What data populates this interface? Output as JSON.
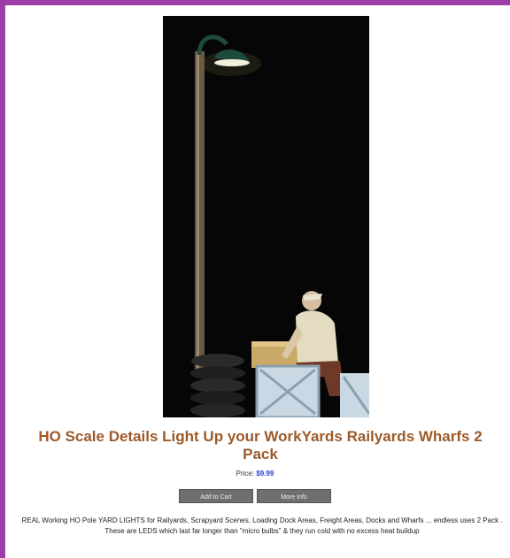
{
  "product": {
    "title": "HO Scale Details Light Up your WorkYards Railyards Wharfs 2 Pack",
    "title_line1": "HO Scale Details Light Up your WorkYards Railyards Wharfs 2",
    "title_line2": "Pack",
    "price_label": "Price: ",
    "price_value": "$9.99",
    "add_to_cart_label": "Add to Cart",
    "more_info_label": "More Info",
    "description": "REAL Working HO Pole YARD LIGHTS for Railyards, Scrapyard Scenes, Loading Dock Areas, Freight Areas, Docks and Wharfs ... endless uses 2 Pack . These are LEDS which last far longer than \"micro bulbs\" & they run cold with no excess heat buildup"
  },
  "colors": {
    "frame": "#9b3fa6",
    "title": "#9c5a2a",
    "price": "#2244cc",
    "button": "#6f6f6f"
  }
}
